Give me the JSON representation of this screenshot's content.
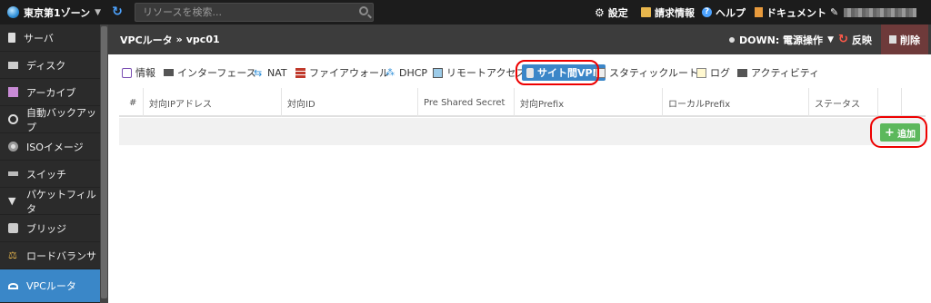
{
  "topbar": {
    "zone": "東京第1ゾーン",
    "search_placeholder": "リソースを検索...",
    "settings": "設定",
    "billing": "請求情報",
    "help": "ヘルプ",
    "docs": "ドキュメント"
  },
  "sidebar": {
    "items": [
      {
        "label": "サーバ",
        "icon": "server-icon"
      },
      {
        "label": "ディスク",
        "icon": "disk-icon"
      },
      {
        "label": "アーカイブ",
        "icon": "archive-icon"
      },
      {
        "label": "自動バックアップ",
        "icon": "backup-icon"
      },
      {
        "label": "ISOイメージ",
        "icon": "iso-icon"
      },
      {
        "label": "スイッチ",
        "icon": "switch-icon"
      },
      {
        "label": "パケットフィルタ",
        "icon": "filter-icon"
      },
      {
        "label": "ブリッジ",
        "icon": "bridge-icon"
      },
      {
        "label": "ロードバランサ",
        "icon": "loadbalancer-icon"
      },
      {
        "label": "VPCルータ",
        "icon": "vpc-router-icon",
        "active": true
      }
    ]
  },
  "header": {
    "breadcrumb_root": "VPCルータ",
    "breadcrumb_sep": "»",
    "breadcrumb_current": "vpc01",
    "status": "DOWN: 電源操作",
    "reflect": "反映",
    "delete": "削除"
  },
  "tabs": [
    {
      "label": "情報",
      "icon": "info-icon"
    },
    {
      "label": "インターフェース",
      "icon": "interface-icon"
    },
    {
      "label": "NAT",
      "icon": "nat-icon"
    },
    {
      "label": "ファイアウォール",
      "icon": "firewall-icon"
    },
    {
      "label": "DHCP",
      "icon": "dhcp-icon"
    },
    {
      "label": "リモートアクセス",
      "icon": "remote-access-icon"
    },
    {
      "label": "サイト間VPN",
      "icon": "vpn-icon",
      "active": true
    },
    {
      "label": "スタティックルート",
      "icon": "static-route-icon"
    },
    {
      "label": "ログ",
      "icon": "log-icon"
    },
    {
      "label": "アクティビティ",
      "icon": "activity-icon"
    }
  ],
  "table": {
    "columns": [
      "#",
      "対向IPアドレス",
      "対向ID",
      "Pre Shared Secret",
      "対向Prefix",
      "ローカルPrefix",
      "ステータス"
    ]
  },
  "add_button": "追加",
  "colors": {
    "active_blue": "#3b86c8",
    "add_green": "#5cb85c",
    "highlight_red": "#e00000"
  }
}
